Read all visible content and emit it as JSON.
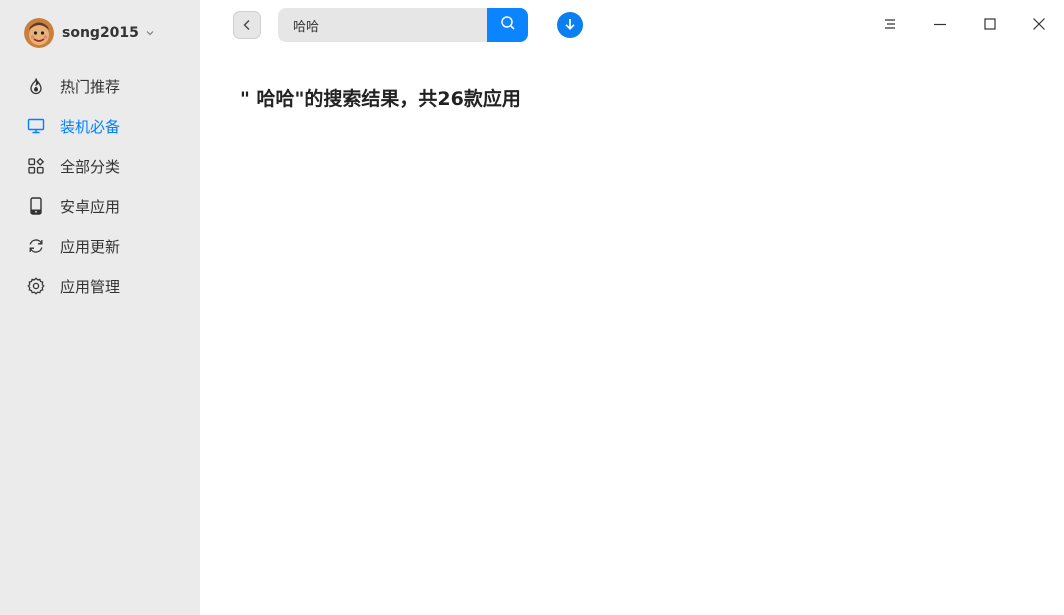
{
  "user": {
    "name": "song2015"
  },
  "nav": [
    {
      "label": "热门推荐",
      "icon": "flame-icon"
    },
    {
      "label": "装机必备",
      "icon": "monitor-icon",
      "active": true
    },
    {
      "label": "全部分类",
      "icon": "grid-icon"
    },
    {
      "label": "安卓应用",
      "icon": "phone-icon"
    },
    {
      "label": "应用更新",
      "icon": "refresh-icon"
    },
    {
      "label": "应用管理",
      "icon": "gear-icon"
    }
  ],
  "search": {
    "value": "哈哈"
  },
  "result": {
    "title": "\" 哈哈\"的搜索结果，共26款应用"
  },
  "colors": {
    "accent": "#0081ff",
    "sidebar": "#ebebeb",
    "search_button": "#0a84ff"
  }
}
